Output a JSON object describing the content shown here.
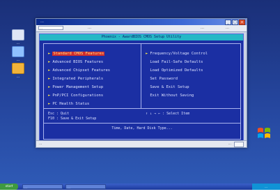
{
  "window": {
    "title": "…",
    "buttons": {
      "minimize": "_",
      "maximize": "□",
      "close": "x"
    }
  },
  "toolbar": {
    "address": "…",
    "items": [
      "…",
      "…",
      "…"
    ]
  },
  "desktop_icons": [
    {
      "label": "…",
      "icon": "computer-icon",
      "color": "#e0e6f5"
    },
    {
      "label": "…",
      "icon": "network-icon",
      "color": "#8fc1ff"
    },
    {
      "label": "…",
      "icon": "folder-icon",
      "color": "#f2b43a"
    }
  ],
  "bios": {
    "header": "Phoenix - AwardBIOS CMOS Setup Utility",
    "left_menu": [
      {
        "label": "Standard CMOS Features",
        "selected": true
      },
      {
        "label": "Advanced BIOS Features",
        "selected": false
      },
      {
        "label": "Advanced Chipset Features",
        "selected": false
      },
      {
        "label": "Integrated Peripherals",
        "selected": false
      },
      {
        "label": "Power Management Setup",
        "selected": false
      },
      {
        "label": "PnP/PCI Configurations",
        "selected": false
      },
      {
        "label": "PC Health Status",
        "selected": false
      }
    ],
    "right_menu": [
      {
        "label": "Frequency/Voltage Control",
        "marker": true
      },
      {
        "label": "Load Fail-Safe Defaults",
        "marker": false
      },
      {
        "label": "Load Optimized Defaults",
        "marker": false
      },
      {
        "label": "Set Password",
        "marker": false
      },
      {
        "label": "Save & Exit Setup",
        "marker": false
      },
      {
        "label": "Exit Without Saving",
        "marker": false
      }
    ],
    "key_help": {
      "esc": "Esc : Quit",
      "f10": "F10 : Save & Exit Setup",
      "select": "↑ ↓ → ← : Select Item"
    },
    "description": "Time, Date, Hard Disk Type..."
  },
  "statusbar": {
    "left": "…",
    "right": "…"
  },
  "taskbar": {
    "start": "start",
    "tasks": [
      "…",
      "…"
    ],
    "tray": "…"
  },
  "colors": {
    "bios_bg": "#1b2fa3",
    "bios_header": "#26b8c6",
    "selected_highlight": "#d12d2d",
    "desktop_bg": "#25469e"
  }
}
